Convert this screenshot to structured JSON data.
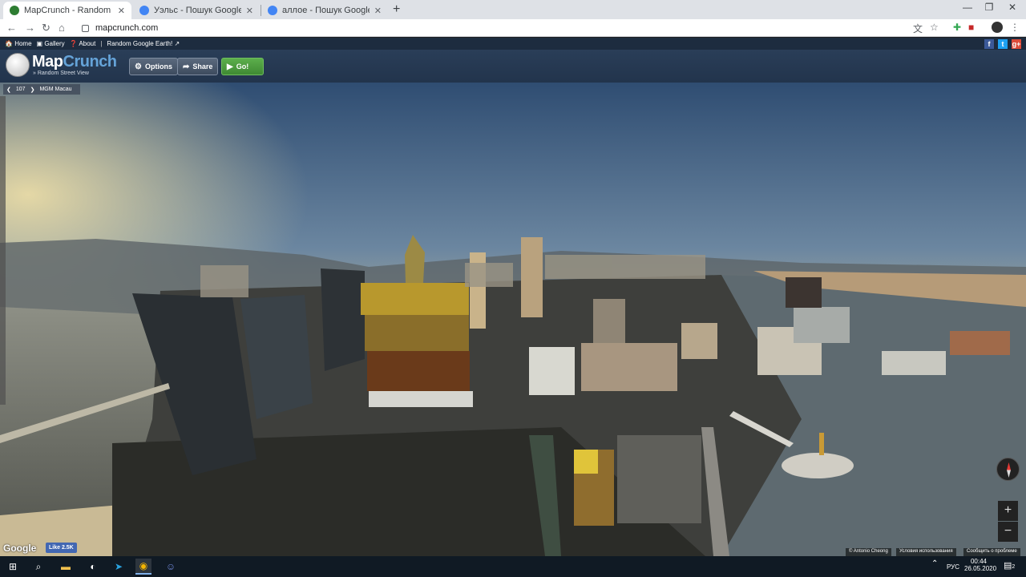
{
  "browser": {
    "tabs": [
      {
        "title": "MapCrunch - Random Street View",
        "favicon_color": "#2e7d32"
      },
      {
        "title": "Уэльс - Пошук Google",
        "favicon_color": "#4285f4"
      },
      {
        "title": "аллое - Пошук Google",
        "favicon_color": "#4285f4"
      }
    ],
    "new_tab": "+",
    "url": "mapcrunch.com"
  },
  "mapcrunch": {
    "top_links": [
      "Home",
      "Gallery",
      "About",
      "Random Google Earth!"
    ],
    "logo": {
      "map": "Map",
      "crunch": "Crunch",
      "tagline": "» Random Street View"
    },
    "buttons": {
      "options": "Options",
      "share": "Share",
      "go": "Go!"
    },
    "location": {
      "count": "107",
      "name": "MGM Macau"
    },
    "social": {
      "facebook": "f",
      "twitter": "t",
      "google": "g+"
    }
  },
  "streetview": {
    "google_logo": "Google",
    "fb_like": "Like 2.5K",
    "attribution": [
      "© Antonio Cheong",
      "Условия использования",
      "Сообщить о проблеме"
    ]
  },
  "taskbar": {
    "language": "РУС",
    "time": "00:44",
    "date": "26.05.2020",
    "notifications": "2"
  }
}
